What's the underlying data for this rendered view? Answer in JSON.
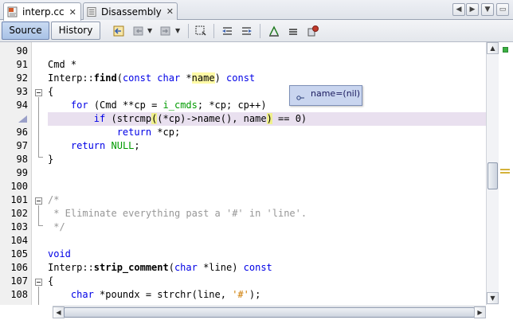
{
  "tabs": [
    {
      "label": "interp.cc",
      "active": true,
      "close": "✕"
    },
    {
      "label": "Disassembly",
      "active": false,
      "close": "✕"
    }
  ],
  "tab_nav": {
    "left": "◀",
    "right": "▶",
    "menu": "▼",
    "restore": "▭"
  },
  "toolbar": {
    "source_label": "Source",
    "history_label": "History",
    "icons": [
      "back-history-icon",
      "navigate-back-icon",
      "navigate-forward-icon",
      "toggle-selection-icon",
      "shift-left-icon",
      "shift-right-icon",
      "comment-icon",
      "uncomment-icon",
      "macro-icon"
    ]
  },
  "tooltip": {
    "text": "name=(nil)"
  },
  "lines": [
    {
      "num": "90"
    },
    {
      "num": "91"
    },
    {
      "num": "92"
    },
    {
      "num": "93"
    },
    {
      "num": "94"
    },
    {
      "num": ""
    },
    {
      "num": "96"
    },
    {
      "num": "97"
    },
    {
      "num": "98"
    },
    {
      "num": "99"
    },
    {
      "num": "100"
    },
    {
      "num": "101"
    },
    {
      "num": "102"
    },
    {
      "num": "103"
    },
    {
      "num": "104"
    },
    {
      "num": "105"
    },
    {
      "num": "106"
    },
    {
      "num": "107"
    },
    {
      "num": "108"
    }
  ],
  "code": {
    "l91": {
      "a": "Cmd *"
    },
    "l92": {
      "a": "Interp::",
      "fn": "find",
      "b": "(",
      "kw1": "const",
      "c": " ",
      "kw2": "char",
      "d": " *",
      "mark": "name",
      "e": ") ",
      "kw3": "const"
    },
    "l93": {
      "a": "{"
    },
    "l94": {
      "ind": "    ",
      "kw1": "for",
      "a": " (Cmd **cp = ",
      "ln": "i_cmds",
      "b": "; *cp; cp++)"
    },
    "l95": {
      "ind": "        ",
      "kw1": "if",
      "a": " (strcmp",
      "br1": "(",
      "b": "(*cp)->name(), name",
      "br2": ")",
      "c": " == 0)"
    },
    "l96": {
      "ind": "            ",
      "kw1": "return",
      "a": " *cp;"
    },
    "l97": {
      "ind": "    ",
      "kw1": "return",
      "a": " ",
      "ln": "NULL",
      "b": ";"
    },
    "l98": {
      "a": "}"
    },
    "l101": {
      "a": "/*"
    },
    "l102": {
      "a": " * Eliminate everything past a '#' in 'line'."
    },
    "l103": {
      "a": " */"
    },
    "l105": {
      "kw1": "void"
    },
    "l106": {
      "a": "Interp::",
      "fn": "strip_comment",
      "b": "(",
      "kw1": "char",
      "c": " *line) ",
      "kw2": "const"
    },
    "l107": {
      "a": "{"
    },
    "l108": {
      "ind": "    ",
      "kw1": "char",
      "a": " *poundx = strchr(line, ",
      "st": "'#'",
      "b": ");"
    }
  },
  "colors": {
    "keyword": "#0000e6",
    "comment": "#969696",
    "local": "#009b00",
    "string": "#ce7b00",
    "current_line": "#e9e0ef",
    "occurrence": "#fffaa6",
    "tooltip_bg": "#c9d5ef"
  }
}
